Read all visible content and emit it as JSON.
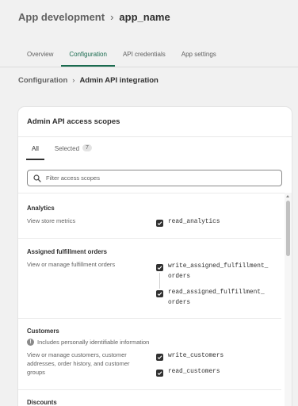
{
  "header": {
    "breadcrumb_root": "App development",
    "breadcrumb_current": "app_name",
    "tabs": [
      {
        "label": "Overview"
      },
      {
        "label": "Configuration"
      },
      {
        "label": "API credentials"
      },
      {
        "label": "App settings"
      }
    ]
  },
  "subheader": {
    "breadcrumb_root": "Configuration",
    "breadcrumb_current": "Admin API integration"
  },
  "card": {
    "title": "Admin API access scopes",
    "tabs": {
      "all_label": "All",
      "selected_label": "Selected",
      "selected_count": "7"
    },
    "search": {
      "placeholder": "Filter access scopes"
    },
    "sections": [
      {
        "title": "Analytics",
        "description": "View store metrics",
        "permissions": [
          "read_analytics"
        ]
      },
      {
        "title": "Assigned fulfillment orders",
        "description": "View or manage fulfillment orders",
        "permissions": [
          "write_assigned_fulfillment_\norders",
          "read_assigned_fulfillment_\norders"
        ]
      },
      {
        "title": "Customers",
        "info": "Includes personally identifiable information",
        "description": "View or manage customers, customer addresses, order history, and customer groups",
        "permissions": [
          "write_customers",
          "read_customers"
        ]
      },
      {
        "title": "Discounts"
      }
    ]
  },
  "colors": {
    "accent_green": "#1a6b4f",
    "checkbox": "#303030",
    "background": "#f1f1f1"
  },
  "icons": {
    "search": "search-icon",
    "checkbox": "checkmark-icon",
    "info": "info-icon",
    "chevron": "chevron-right-icon"
  }
}
